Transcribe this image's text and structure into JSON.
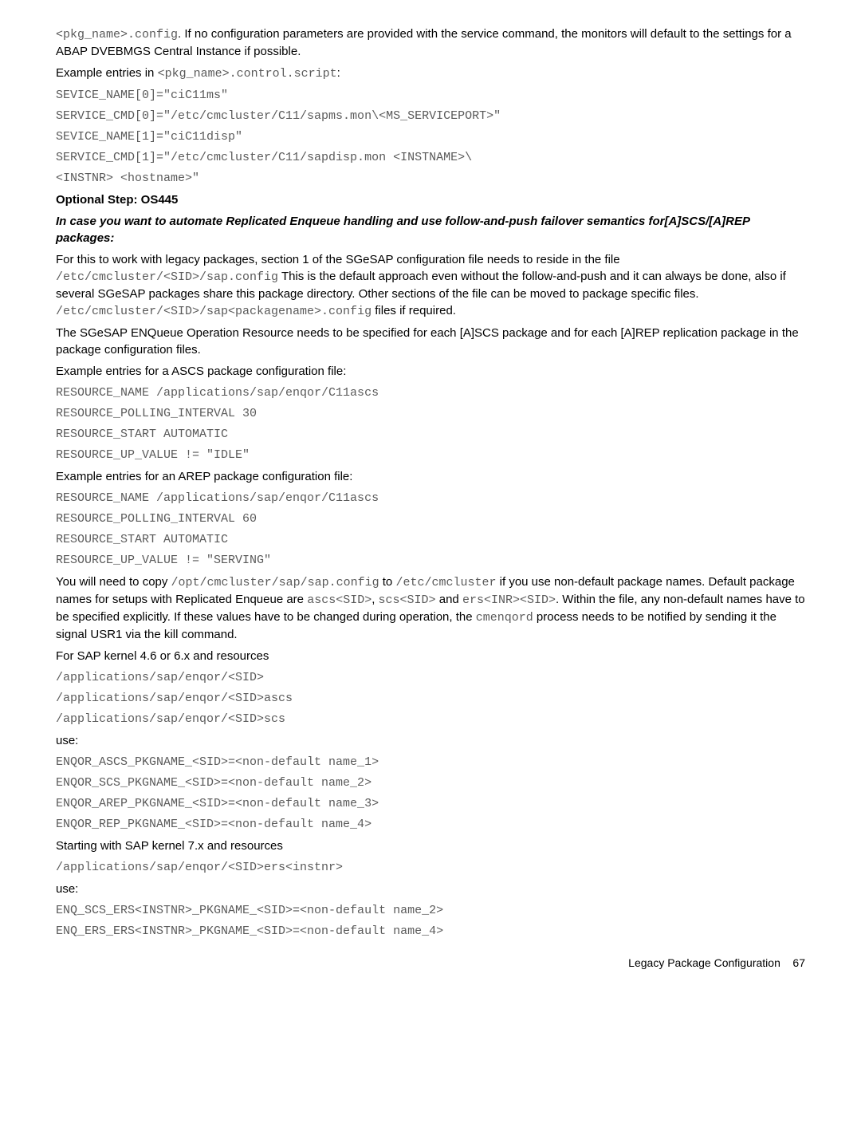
{
  "intro": {
    "p1_a": "<pkg_name>.config",
    "p1_b": ". If no configuration parameters are provided with the service command, the monitors will default to the settings for a ABAP DVEBMGS Central Instance if possible.",
    "p2_a": "Example entries in ",
    "p2_b": "<pkg_name>.control.script",
    "p2_c": ":"
  },
  "codeA": {
    "l1": "SEVICE_NAME[0]=\"ciC11ms\"",
    "l2": "SERVICE_CMD[0]=\"/etc/cmcluster/C11/sapms.mon\\<MS_SERVICEPORT>\"",
    "l3": "SEVICE_NAME[1]=\"ciC11disp\"",
    "l4": "SERVICE_CMD[1]=\"/etc/cmcluster/C11/sapdisp.mon <INSTNAME>\\",
    "l5": "<INSTNR> <hostname>\""
  },
  "h1": "Optional Step: OS445",
  "h2": "In case you want to automate Replicated Enqueue handling and use follow-and-push failover semantics for[A]SCS/[A]REP packages:",
  "p3_a": "For this to work with legacy packages, section 1 of the SGeSAP configuration file needs to reside in the file ",
  "p3_b": "/etc/cmcluster/<SID>/sap.config",
  "p3_c": " This is the default approach even without the follow-and-push and it can always be done, also if several SGeSAP packages share this package directory. Other sections of the file can be moved to package specific files. ",
  "p3_d": "/etc/cmcluster/<SID>/sap<packagename>.config",
  "p3_e": " files if required.",
  "p4": "The SGeSAP ENQueue Operation Resource needs to be specified for each [A]SCS package and for each [A]REP replication package in the package configuration files.",
  "p5": "Example entries for a ASCS package configuration file:",
  "codeB": {
    "l1": "RESOURCE_NAME /applications/sap/enqor/C11ascs",
    "l2": "RESOURCE_POLLING_INTERVAL 30",
    "l3": "RESOURCE_START AUTOMATIC",
    "l4": "RESOURCE_UP_VALUE != \"IDLE\""
  },
  "p6": "Example entries for an AREP package configuration file:",
  "codeC": {
    "l1": "RESOURCE_NAME /applications/sap/enqor/C11ascs",
    "l2": "RESOURCE_POLLING_INTERVAL 60",
    "l3": "RESOURCE_START AUTOMATIC",
    "l4": "RESOURCE_UP_VALUE != \"SERVING\""
  },
  "p7_a": "You will need to copy ",
  "p7_b": "/opt/cmcluster/sap/sap.config",
  "p7_c": " to ",
  "p7_d": "/etc/cmcluster",
  "p7_e": " if you use non-default package names. Default package names for setups with Replicated Enqueue are ",
  "p7_f": "ascs<SID>",
  "p7_g": ", ",
  "p7_h": "scs<SID>",
  "p7_i": " and ",
  "p7_j": "ers<INR><SID>",
  "p7_k": ". Within the file, any non-default names have to be specified explicitly. If these values have to be changed during operation, the ",
  "p7_l": "cmenqord",
  "p7_m": " process needs to be notified by sending it the signal USR1 via the kill command.",
  "p8": "For SAP kernel 4.6 or 6.x and resources",
  "codeD": {
    "l1": "/applications/sap/enqor/<SID>",
    "l2": "/applications/sap/enqor/<SID>ascs",
    "l3": "/applications/sap/enqor/<SID>scs"
  },
  "p9": "use:",
  "codeE": {
    "l1": "ENQOR_ASCS_PKGNAME_<SID>=<non-default name_1>",
    "l2": "ENQOR_SCS_PKGNAME_<SID>=<non-default name_2>",
    "l3": "ENQOR_AREP_PKGNAME_<SID>=<non-default name_3>",
    "l4": "ENQOR_REP_PKGNAME_<SID>=<non-default name_4>"
  },
  "p10": "Starting with SAP kernel 7.x and resources",
  "codeF": {
    "l1": "/applications/sap/enqor/<SID>ers<instnr>"
  },
  "p11": "use:",
  "codeG": {
    "l1": "ENQ_SCS_ERS<INSTNR>_PKGNAME_<SID>=<non-default name_2>",
    "l2": "ENQ_ERS_ERS<INSTNR>_PKGNAME_<SID>=<non-default name_4>"
  },
  "footer": {
    "label": "Legacy Package Configuration",
    "page": "67"
  }
}
